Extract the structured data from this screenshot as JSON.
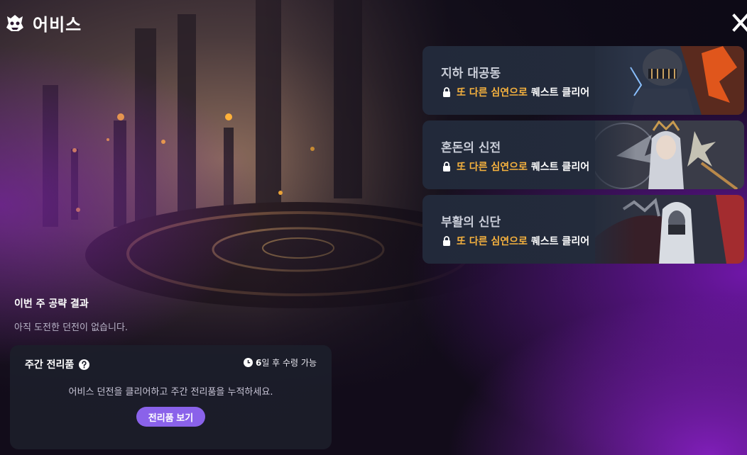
{
  "header": {
    "title": "어비스",
    "logo_icon": "demon-head-icon",
    "close_icon": "close-icon"
  },
  "dungeons": [
    {
      "name": "지하 대공동",
      "requirement_highlight": "또 다른 심연으로",
      "requirement_text": "퀘스트 클리어",
      "locked": true
    },
    {
      "name": "혼돈의 신전",
      "requirement_highlight": "또 다른 심연으로",
      "requirement_text": "퀘스트 클리어",
      "locked": true
    },
    {
      "name": "부활의 신단",
      "requirement_highlight": "또 다른 심연으로",
      "requirement_text": "퀘스트 클리어",
      "locked": true
    }
  ],
  "weekly_result": {
    "title": "이번 주 공략 결과",
    "subtitle": "아직 도전한 던전이 없습니다."
  },
  "weekly_reward": {
    "title": "주간 전리품",
    "timer_value": "6",
    "timer_suffix": "일 후 수령 가능",
    "description": "어비스 던전을 클리어하고 주간 전리품을 누적하세요.",
    "button_label": "전리품 보기"
  },
  "colors": {
    "highlight": "#f6b23e",
    "button": "#8a62ea",
    "card_bg": "#232b3b"
  }
}
